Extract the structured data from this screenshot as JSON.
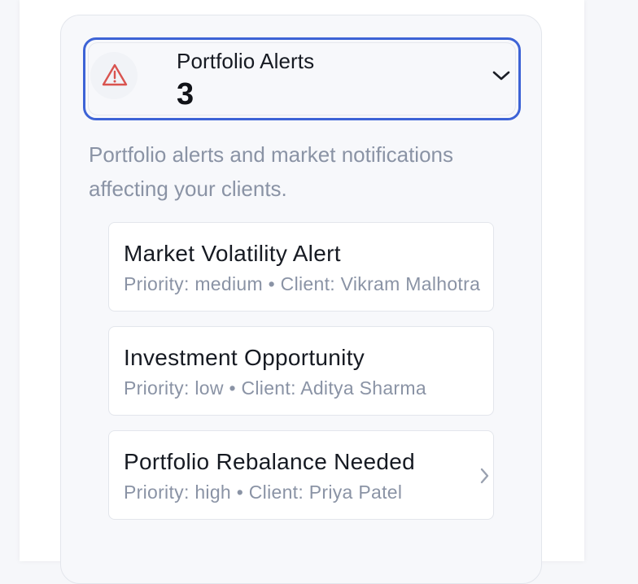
{
  "alerts_panel": {
    "header": {
      "icon": "warning-triangle-icon",
      "title": "Portfolio Alerts",
      "count": "3",
      "expanded_icon": "chevron-down-icon"
    },
    "description": "Portfolio alerts and market notifications affecting your clients.",
    "items": [
      {
        "title": "Market Volatility Alert",
        "subtitle": "Priority: medium • Client: Vikram Malhotra"
      },
      {
        "title": "Investment Opportunity",
        "subtitle": "Priority: low • Client: Aditya Sharma"
      },
      {
        "title": "Portfolio Rebalance Needed",
        "subtitle": "Priority: high • Client: Priya Patel"
      }
    ]
  },
  "colors": {
    "accent": "#3d63d6",
    "warning": "#d9534f",
    "muted_text": "#8a93a5"
  }
}
